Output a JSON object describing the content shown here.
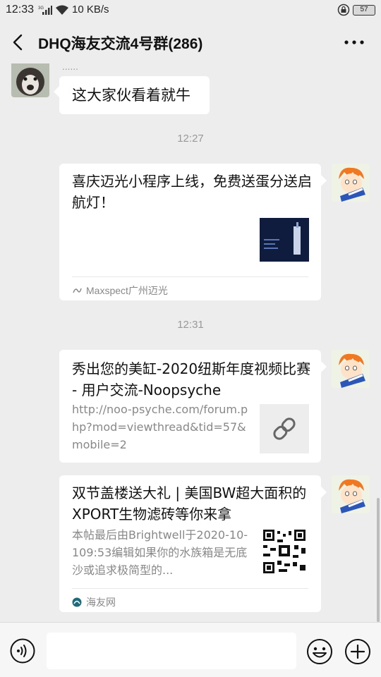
{
  "status_bar": {
    "time": "12:33",
    "network": "10 KB/s",
    "battery": "57"
  },
  "header": {
    "title": "DHQ海友交流4号群(286)"
  },
  "messages": [
    {
      "sender_name": "......",
      "text": "这大家伙看着就牛"
    },
    {
      "timestamp": "12:27",
      "card": {
        "title": "喜庆迈光小程序上线，免费送蛋分送启航灯！",
        "source": "Maxspect广州迈光"
      }
    },
    {
      "timestamp": "12:31",
      "card": {
        "title": "秀出您的美缸-2020纽斯年度视频比赛 - 用户交流-Noopsyche",
        "desc": "http://noo-psyche.com/forum.php?mod=viewthread&tid=57&mobile=2"
      }
    },
    {
      "card": {
        "title": "双节盖楼送大礼 | 美国BW超大面积的XPORT生物滤砖等你来拿",
        "desc": "本帖最后由Brightwell于2020-10-109:53编辑如果你的水族箱是无底沙或追求极简型的...",
        "source": "海友网"
      }
    }
  ],
  "colors": {
    "background": "#ededed",
    "bubble": "#ffffff",
    "timestamp": "#999999"
  }
}
